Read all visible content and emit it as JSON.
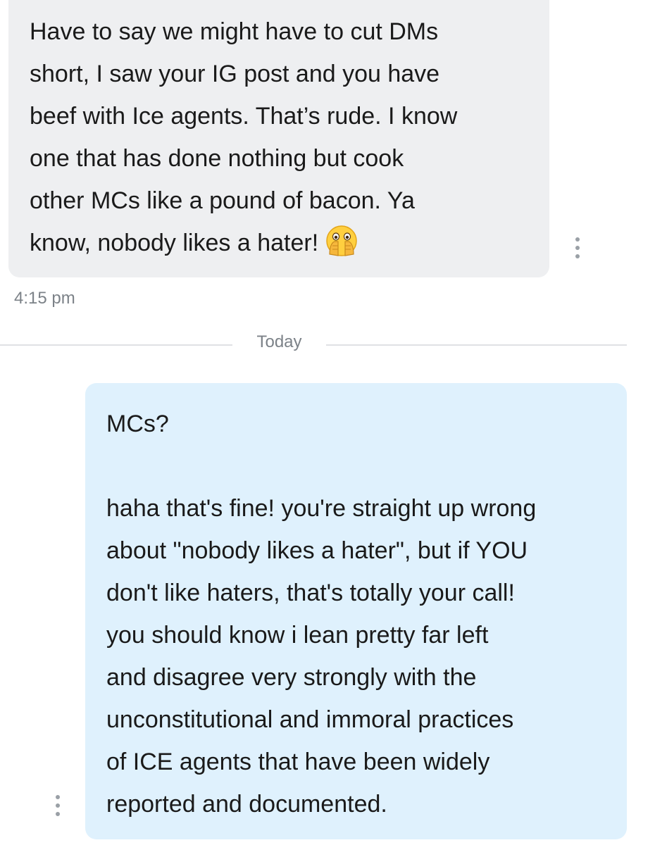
{
  "conversation": {
    "incoming_message": {
      "lines": [
        "Have to say we might have to cut DMs",
        "short, I saw your IG post and you have",
        "beef with Ice agents. That’s rude. I know",
        "one that has done nothing but cook",
        "other MCs like a pound of bacon. Ya",
        "know, nobody likes a hater!"
      ],
      "emoji": "face-with-open-eyes-and-hand-over-mouth-icon",
      "timestamp": "4:15 pm"
    },
    "day_divider": "Today",
    "outgoing_message": {
      "paragraph_1": "MCs?",
      "paragraph_2_lines": [
        "haha that's fine! you're straight up wrong",
        "about \"nobody likes a hater\", but if YOU",
        "don't like haters, that's totally your call!",
        "you should know i lean pretty far left",
        "and disagree very strongly with the",
        "unconstitutional and immoral practices",
        "of ICE agents that have been widely",
        "reported and documented."
      ]
    }
  },
  "colors": {
    "incoming_bubble": "#eeeff1",
    "outgoing_bubble": "#dff1fd",
    "message_text": "#1a1a1a",
    "meta_text": "#7c8288",
    "more_dots": "#9aa0a6"
  }
}
